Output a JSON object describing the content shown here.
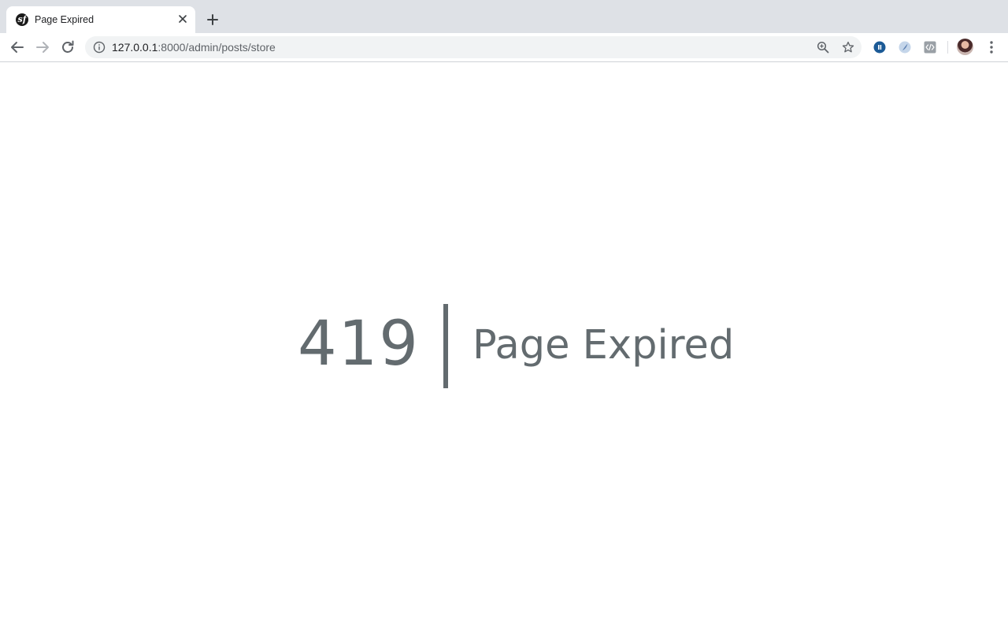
{
  "tab": {
    "title": "Page Expired",
    "favicon": "symfony-logo-icon"
  },
  "toolbar": {
    "url_host": "127.0.0.1",
    "url_rest": ":8000/admin/posts/store",
    "icons": [
      "back-arrow-icon",
      "forward-arrow-icon",
      "reload-icon",
      "info-icon",
      "zoom-icon",
      "star-icon",
      "menu-dots-icon"
    ],
    "extensions": [
      "blue-extension-icon",
      "feather-extension-icon",
      "code-extension-icon"
    ]
  },
  "page": {
    "code": "419",
    "message": "Page Expired",
    "text_color": "#636b6f"
  }
}
